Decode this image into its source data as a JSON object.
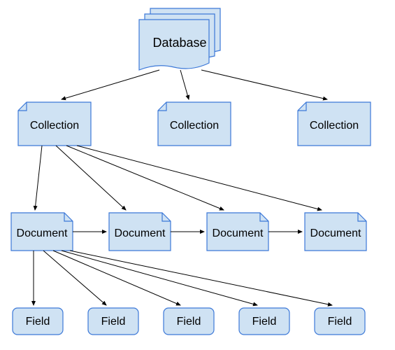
{
  "diagram": {
    "database": {
      "label": "Database"
    },
    "collections": [
      {
        "label": "Collection"
      },
      {
        "label": "Collection"
      },
      {
        "label": "Collection"
      }
    ],
    "documents": [
      {
        "label": "Document"
      },
      {
        "label": "Document"
      },
      {
        "label": "Document"
      },
      {
        "label": "Document"
      }
    ],
    "fields": [
      {
        "label": "Field"
      },
      {
        "label": "Field"
      },
      {
        "label": "Field"
      },
      {
        "label": "Field"
      },
      {
        "label": "Field"
      }
    ]
  }
}
